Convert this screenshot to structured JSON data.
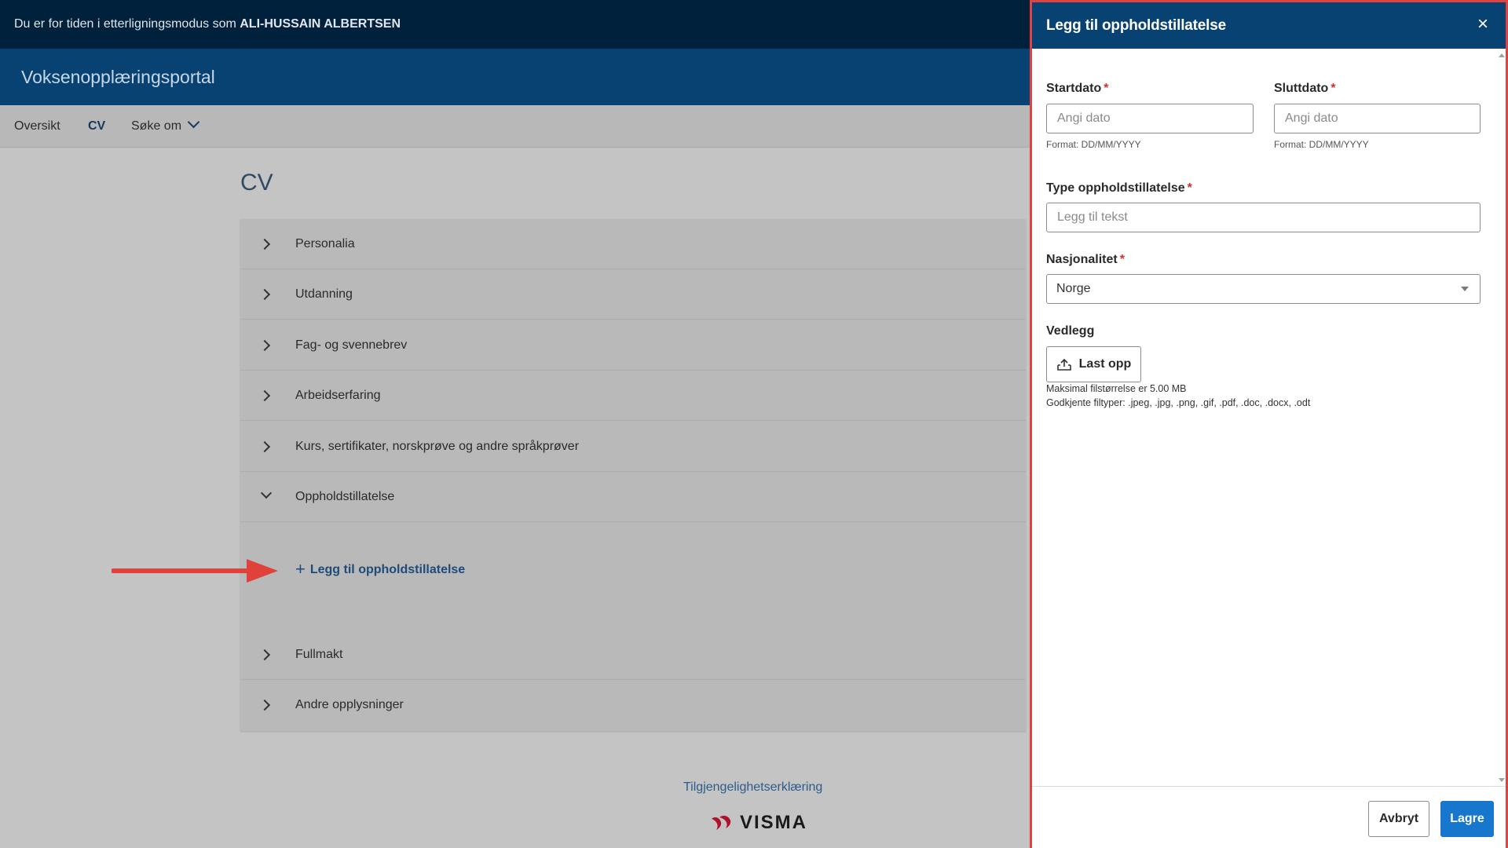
{
  "impersonation": {
    "prefix": "Du er for tiden i etterligningsmodus som",
    "user": "ALI-HUSSAIN ALBERTSEN"
  },
  "brand": {
    "title": "Voksenopplæringsportal"
  },
  "nav": {
    "overview": "Oversikt",
    "cv": "CV",
    "apply": "Søke om"
  },
  "page": {
    "title": "CV"
  },
  "accordion": {
    "items": [
      {
        "label": "Personalia"
      },
      {
        "label": "Utdanning"
      },
      {
        "label": "Fag- og svennebrev"
      },
      {
        "label": "Arbeidserfaring"
      },
      {
        "label": "Kurs, sertifikater, norskprøve og andre språkprøver"
      },
      {
        "label": "Oppholdstillatelse"
      },
      {
        "label": "Fullmakt"
      },
      {
        "label": "Andre opplysninger"
      }
    ],
    "add_link": "Legg til oppholdstillatelse"
  },
  "footer": {
    "accessibility_link": "Tilgjengelighetserklæring",
    "logo_text": "VISMA"
  },
  "dialog": {
    "title": "Legg til oppholdstillatelse",
    "close": "×",
    "start_date": {
      "label": "Startdato",
      "required": "*",
      "placeholder": "Angi dato",
      "hint": "Format: DD/MM/YYYY"
    },
    "end_date": {
      "label": "Sluttdato",
      "required": "*",
      "placeholder": "Angi dato",
      "hint": "Format: DD/MM/YYYY"
    },
    "permit_type": {
      "label": "Type oppholdstillatelse",
      "required": "*",
      "placeholder": "Legg til tekst"
    },
    "nationality": {
      "label": "Nasjonalitet",
      "required": "*",
      "value": "Norge"
    },
    "attachment": {
      "label": "Vedlegg",
      "button": "Last opp",
      "max_size": "Maksimal filstørrelse er 5.00 MB",
      "file_types": "Godkjente filtyper: .jpeg, .jpg, .png, .gif, .pdf, .doc, .docx, .odt"
    },
    "cancel": "Avbryt",
    "save": "Lagre"
  },
  "colors": {
    "topbar": "#00213b",
    "brandbar": "#084272",
    "accent": "#1777cc",
    "highlight_border": "#e04141",
    "required": "#d02f2f"
  },
  "icons": [
    "chevron-right-icon",
    "chevron-down-icon",
    "plus-icon",
    "close-icon",
    "upload-icon",
    "caret-down-icon",
    "visma-logo"
  ]
}
